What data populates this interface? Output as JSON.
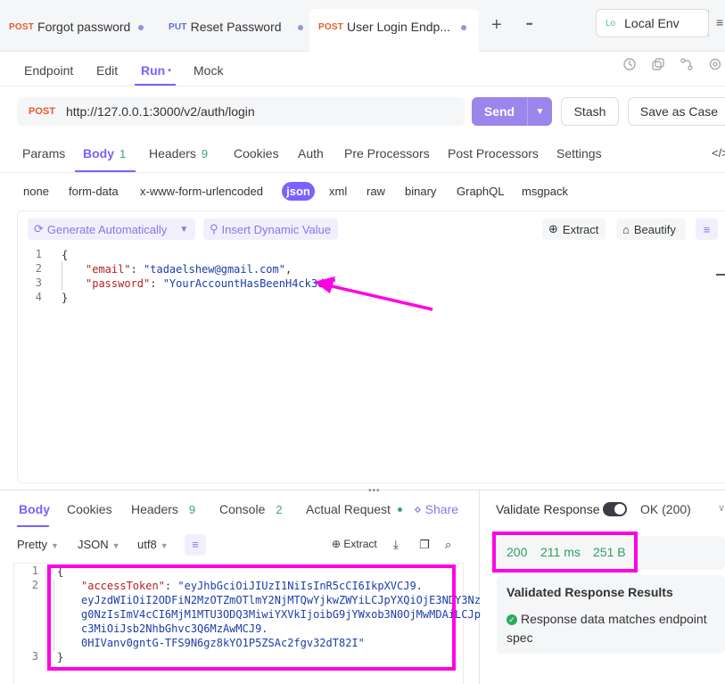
{
  "tabs": [
    {
      "method": "POST",
      "label": "Forgot password"
    },
    {
      "method": "PUT",
      "label": "Reset Password"
    },
    {
      "method": "POST",
      "label": "User Login Endp..."
    }
  ],
  "tab_actions": {
    "add": "+",
    "more": "•••"
  },
  "environment": {
    "badge": "Lo",
    "label": "Local Env"
  },
  "subnav": {
    "endpoint": "Endpoint",
    "edit": "Edit",
    "run": "Run",
    "run_dot": "•",
    "mock": "Mock"
  },
  "request": {
    "method": "POST",
    "url": "http://127.0.0.1:3000/v2/auth/login",
    "send": "Send",
    "stash": "Stash",
    "save_as_case": "Save as Case"
  },
  "request_tabs": {
    "params": "Params",
    "body": "Body",
    "body_count": "1",
    "headers": "Headers",
    "headers_count": "9",
    "cookies": "Cookies",
    "auth": "Auth",
    "pre": "Pre Processors",
    "post": "Post Processors",
    "settings": "Settings"
  },
  "body_types": [
    "none",
    "form-data",
    "x-www-form-urlencoded",
    "json",
    "xml",
    "raw",
    "binary",
    "GraphQL",
    "msgpack"
  ],
  "editor_tools": {
    "generate": "Generate Automatically",
    "dynamic": "Insert Dynamic Value",
    "extract": "Extract",
    "beautify": "Beautify"
  },
  "request_body": {
    "line1": "{",
    "email_key": "\"email\"",
    "email_val": "\"tadaelshew@gmail.com\"",
    "password_key": "\"password\"",
    "password_val": "\"YourAccountHasBeenH4ck3d!\"",
    "line4": "}"
  },
  "response_tabs": {
    "body": "Body",
    "cookies": "Cookies",
    "headers": "Headers",
    "headers_count": "9",
    "console": "Console",
    "console_count": "2",
    "actual": "Actual Request",
    "share": "Share"
  },
  "response_options": {
    "format": "Pretty",
    "lang": "JSON",
    "encoding": "utf8",
    "extract": "Extract"
  },
  "response_body": {
    "line1": "{",
    "token_key": "\"accessToken\"",
    "token_l1": "\"eyJhbGciOiJIUzI1NiIsInR5cCI6IkpXVCJ9.",
    "token_l2": "eyJzdWIiOiI2ODFiN2MzOTZmOTlmY2NjMTQwYjkwZWYiLCJpYXQiOjE3NDY3Nz",
    "token_l3": "g0NzIsImV4cCI6MjM1MTU3ODQ3MiwiYXVkIjoibG9jYWxob3N0OjMwMDAiLCJp",
    "token_l4": "c3MiOiJsb2NhbGhvc3Q6MzAwMCJ9.",
    "token_l5": "0HIVanv0gntG-TFS9N6gz8kYO1P5ZSAc2fgv32dT82I\"",
    "line3": "}"
  },
  "validation": {
    "label": "Validate Response",
    "status": "OK (200)",
    "code": "200",
    "time": "211 ms",
    "size": "251 B",
    "results_title": "Validated Response Results",
    "result_text": "Response data matches endpoint spec"
  },
  "colors": {
    "accent": "#7b61ff",
    "highlight": "#ff00e6",
    "success": "#2e9e62",
    "post": "#e35d2a",
    "put": "#5b6fd8"
  }
}
